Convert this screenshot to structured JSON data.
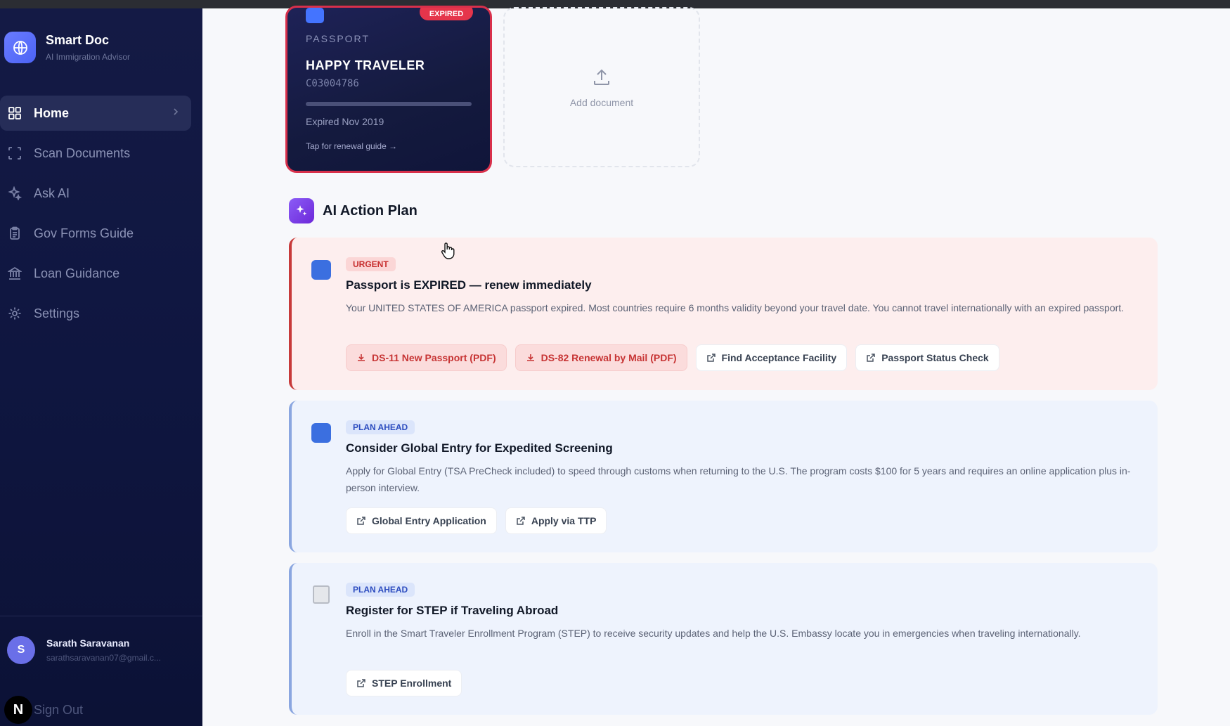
{
  "sidebar": {
    "brand": {
      "title": "Smart Doc",
      "subtitle": "AI Immigration Advisor"
    },
    "nav": [
      {
        "label": "Home",
        "icon": "grid-icon",
        "active": true
      },
      {
        "label": "Scan Documents",
        "icon": "scan-icon"
      },
      {
        "label": "Ask AI",
        "icon": "sparkle-icon"
      },
      {
        "label": "Gov Forms Guide",
        "icon": "clipboard-icon"
      },
      {
        "label": "Loan Guidance",
        "icon": "bank-icon"
      },
      {
        "label": "Settings",
        "icon": "gear-icon"
      }
    ],
    "user": {
      "initial": "S",
      "name": "Sarath Saravanan",
      "email": "sarathsaravanan07@gmail.c..."
    },
    "signout": {
      "badge": "N",
      "label": "Sign Out"
    }
  },
  "passport_card": {
    "badge": "EXPIRED",
    "type": "PASSPORT",
    "name": "HAPPY TRAVELER",
    "number": "C03004786",
    "expired": "Expired Nov 2019",
    "guide": "Tap for renewal guide →"
  },
  "add_document": {
    "label": "Add document"
  },
  "action_plan": {
    "title": "AI Action Plan",
    "cards": [
      {
        "tag": "URGENT",
        "title": "Passport is EXPIRED — renew immediately",
        "description": "Your UNITED STATES OF AMERICA passport expired. Most countries require 6 months validity beyond your travel date. You cannot travel internationally with an expired passport.",
        "buttons": [
          {
            "label": "DS-11 New Passport (PDF)",
            "kind": "pdf"
          },
          {
            "label": "DS-82 Renewal by Mail (PDF)",
            "kind": "pdf"
          },
          {
            "label": "Find Acceptance Facility",
            "kind": "link"
          },
          {
            "label": "Passport Status Check",
            "kind": "link"
          }
        ]
      },
      {
        "tag": "PLAN AHEAD",
        "title": "Consider Global Entry for Expedited Screening",
        "description": "Apply for Global Entry (TSA PreCheck included) to speed through customs when returning to the U.S. The program costs $100 for 5 years and requires an online application plus in-person interview.",
        "buttons": [
          {
            "label": "Global Entry Application",
            "kind": "link"
          },
          {
            "label": "Apply via TTP",
            "kind": "link"
          }
        ]
      },
      {
        "tag": "PLAN AHEAD",
        "title": "Register for STEP if Traveling Abroad",
        "description": "Enroll in the Smart Traveler Enrollment Program (STEP) to receive security updates and help the U.S. Embassy locate you in emergencies when traveling internationally.",
        "buttons": [
          {
            "label": "STEP Enrollment",
            "kind": "link"
          }
        ]
      }
    ]
  },
  "colors": {
    "sidebar_bg": "#10163f",
    "urgent_red": "#c73a3a",
    "plan_blue": "#8aa6e0",
    "accent_purple": "#7c3aed"
  }
}
